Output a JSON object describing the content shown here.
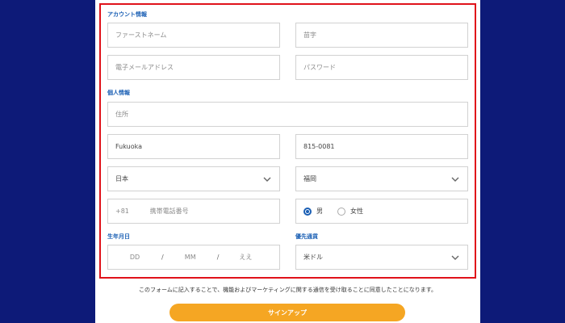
{
  "account_section": {
    "label": "アカウント情報",
    "first_name_placeholder": "ファーストネーム",
    "last_name_placeholder": "苗字",
    "email_placeholder": "電子メールアドレス",
    "password_placeholder": "パスワード"
  },
  "personal_section": {
    "label": "個人情報",
    "address_placeholder": "住所",
    "city_value": "Fukuoka",
    "postal_value": "815-0081",
    "country_value": "日本",
    "prefecture_value": "福岡",
    "phone_code": "+81",
    "phone_placeholder": "携帯電話番号",
    "gender_options": [
      {
        "label": "男",
        "selected": true
      },
      {
        "label": "女性",
        "selected": false
      }
    ]
  },
  "birthdate_section": {
    "label": "生年月日",
    "day_placeholder": "DD",
    "month_placeholder": "MM",
    "year_placeholder": "ええ",
    "separator": "/"
  },
  "currency_section": {
    "label": "優先通貨",
    "value": "米ドル"
  },
  "footer": {
    "notice": "このフォームに記入することで、機能およびマーケティングに関する通信を受け取ることに同意したことになります。",
    "signup_label": "サインアップ"
  },
  "colors": {
    "background": "#0d1a78",
    "highlight_border": "#e0121a",
    "section_label": "#1a5fb4",
    "signup_button": "#f5a623"
  },
  "icons": {
    "select_arrow": "chevron-down-icon"
  }
}
